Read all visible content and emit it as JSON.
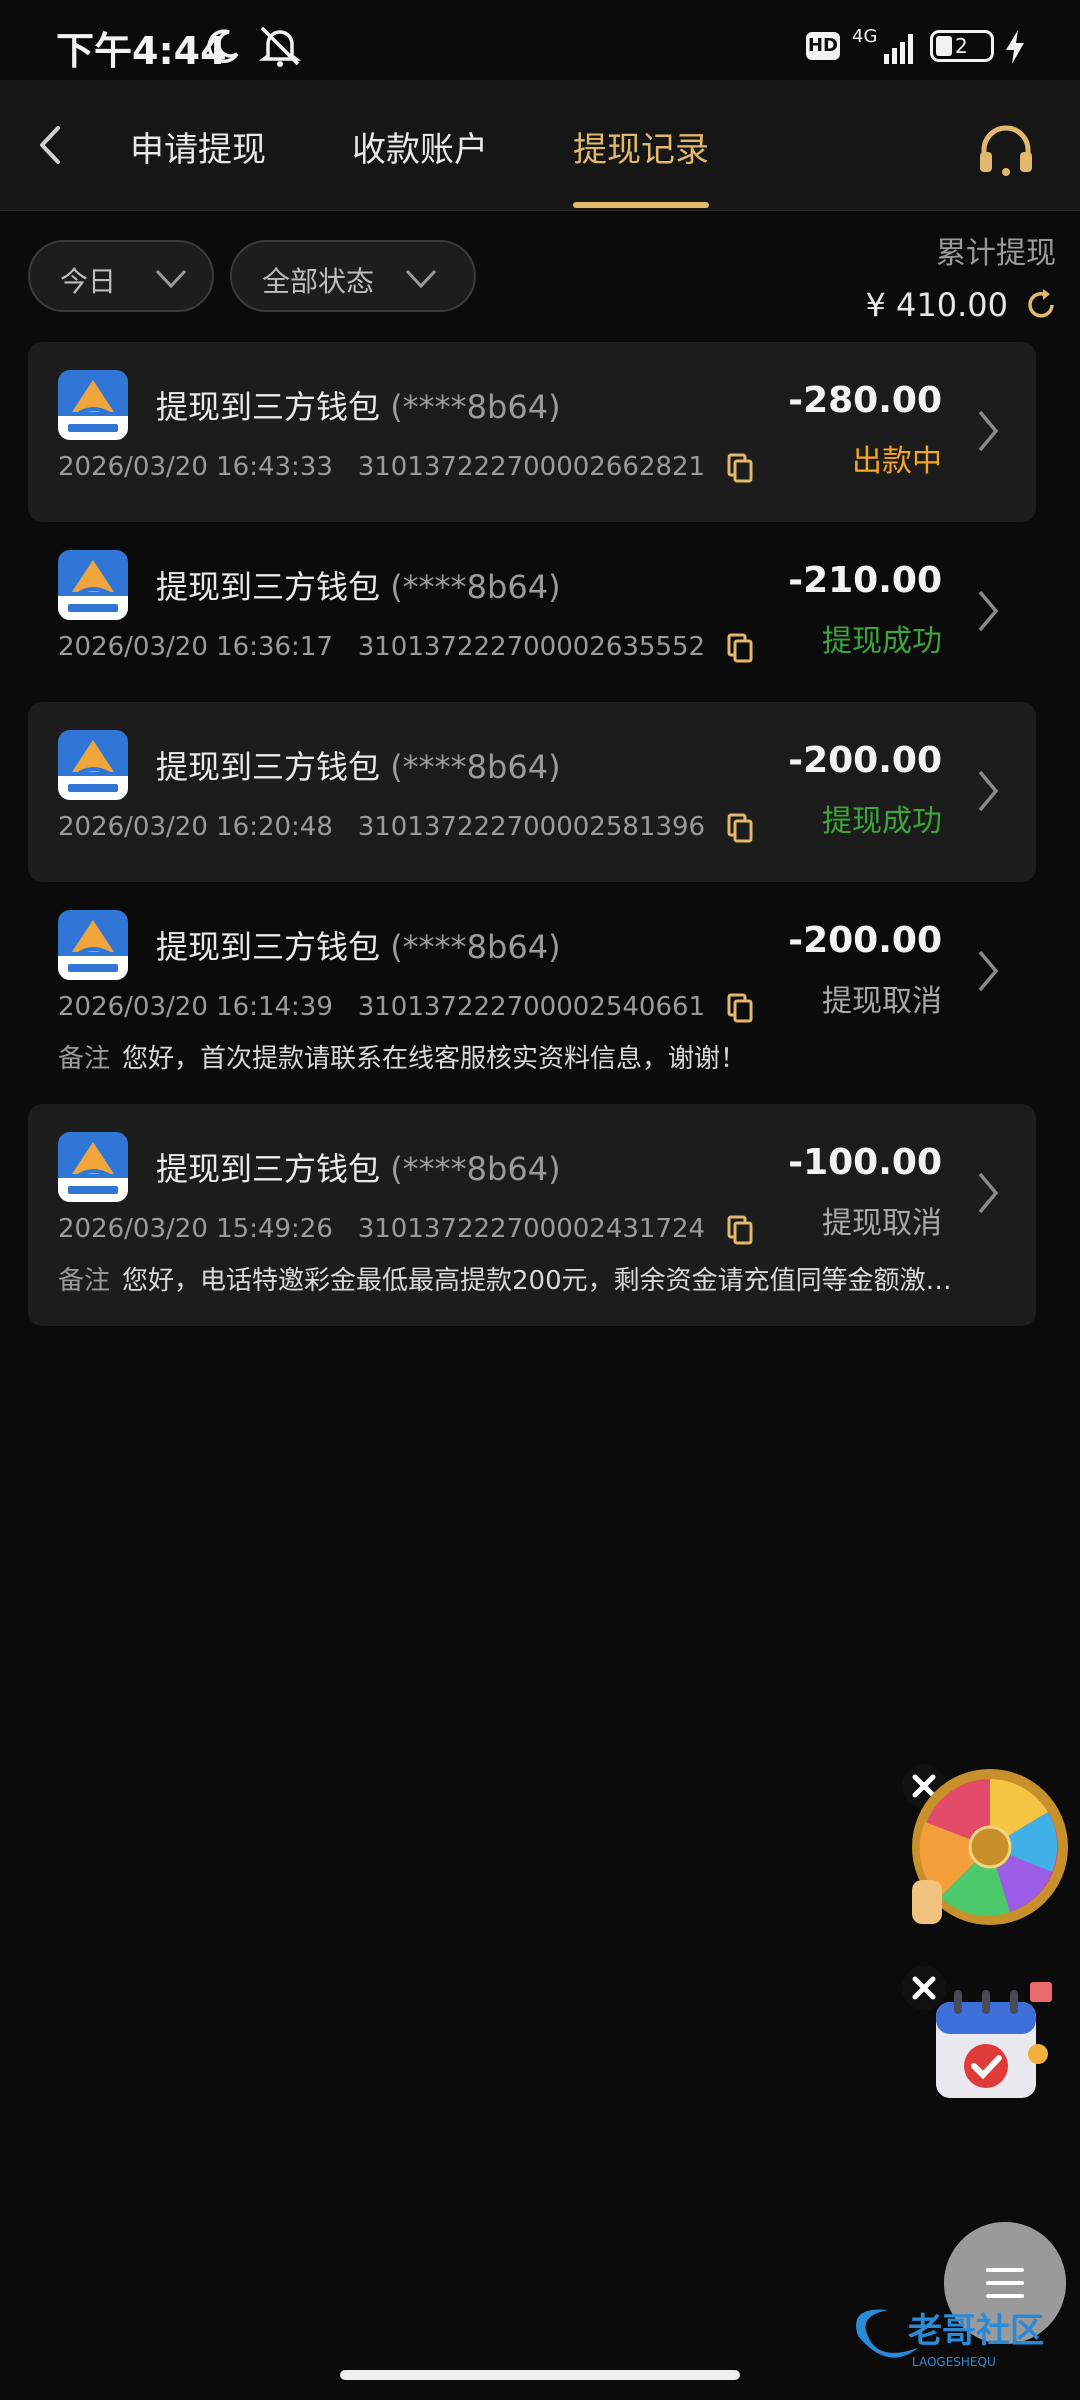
{
  "status_bar": {
    "time": "下午4:44",
    "net": "4G",
    "battery": "2"
  },
  "header": {
    "tabs": [
      {
        "label": "申请提现",
        "active": false
      },
      {
        "label": "收款账户",
        "active": false
      },
      {
        "label": "提现记录",
        "active": true
      }
    ],
    "accent_color": "#e2b86c"
  },
  "filters": {
    "date": "今日",
    "status": "全部状态"
  },
  "summary": {
    "label": "累计提现",
    "value": "¥ 410.00"
  },
  "records": [
    {
      "title": "提现到三方钱包",
      "account": "(****8b64)",
      "datetime": "2026/03/20 16:43:33",
      "order_no": "310137222700002662821",
      "amount": "-280.00",
      "status": "出款中",
      "status_color": "#f5a524",
      "note_label": "",
      "note": ""
    },
    {
      "title": "提现到三方钱包",
      "account": "(****8b64)",
      "datetime": "2026/03/20 16:36:17",
      "order_no": "310137222700002635552",
      "amount": "-210.00",
      "status": "提现成功",
      "status_color": "#3aa63a",
      "note_label": "",
      "note": ""
    },
    {
      "title": "提现到三方钱包",
      "account": "(****8b64)",
      "datetime": "2026/03/20 16:20:48",
      "order_no": "310137222700002581396",
      "amount": "-200.00",
      "status": "提现成功",
      "status_color": "#3aa63a",
      "note_label": "",
      "note": ""
    },
    {
      "title": "提现到三方钱包",
      "account": "(****8b64)",
      "datetime": "2026/03/20 16:14:39",
      "order_no": "310137222700002540661",
      "amount": "-200.00",
      "status": "提现取消",
      "status_color": "#a8a8a8",
      "note_label": "备注",
      "note": "您好，首次提款请联系在线客服核实资料信息，谢谢！"
    },
    {
      "title": "提现到三方钱包",
      "account": "(****8b64)",
      "datetime": "2026/03/20 15:49:26",
      "order_no": "310137222700002431724",
      "amount": "-100.00",
      "status": "提现取消",
      "status_color": "#a8a8a8",
      "note_label": "备注",
      "note": "您好，电话特邀彩金最低最高提款200元，剩余资金请充值同等金额激…"
    }
  ],
  "icons": {
    "back": "chevron-left-icon",
    "support": "headset-icon",
    "refresh": "refresh-icon",
    "copy": "copy-icon",
    "chevron": "chevron-right-icon",
    "close": "close-icon",
    "menu": "menu-icon"
  }
}
